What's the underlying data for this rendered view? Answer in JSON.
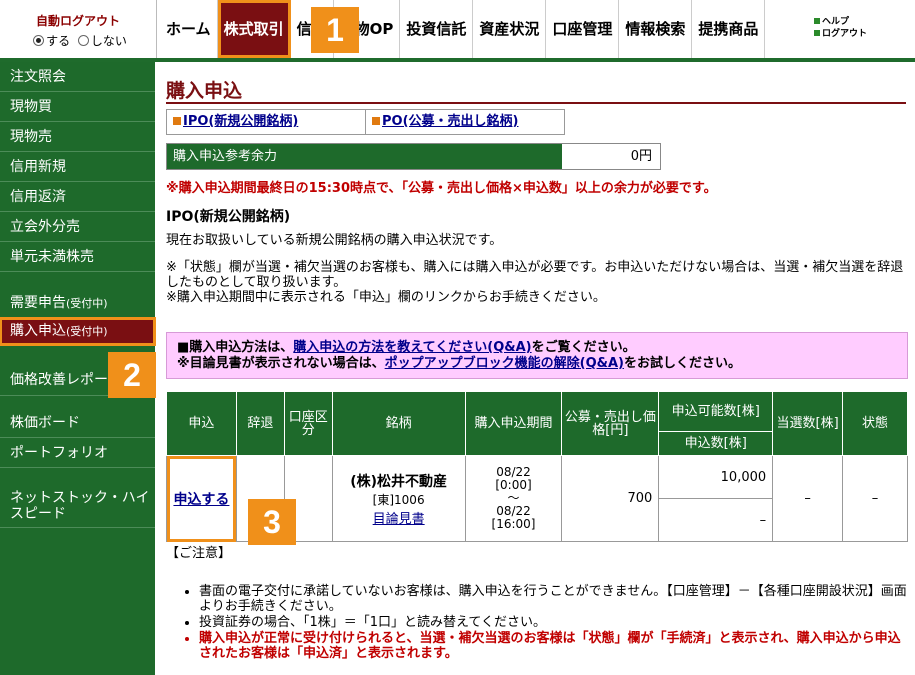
{
  "header": {
    "auto_logout_title": "自動ログアウト",
    "auto_logout_on": "する",
    "auto_logout_off": "しない",
    "nav": [
      "ホーム",
      "株式取引",
      "信用",
      "先物OP",
      "投資信託",
      "資産状況",
      "口座管理",
      "情報検索",
      "提携商品"
    ],
    "help": "ヘルプ",
    "logout": "ログアウト"
  },
  "sidebar": {
    "items": [
      "注文照会",
      "現物買",
      "現物売",
      "信用新規",
      "信用返済",
      "立会外分売",
      "単元未満株売"
    ],
    "demand": "需要申告",
    "demand_sub": "(受付中)",
    "purchase": "購入申込",
    "purchase_sub": "(受付中)",
    "price_report": "価格改善レポート",
    "board": "株価ボード",
    "portfolio": "ポートフォリオ",
    "netstock": "ネットストック・ハイスピード"
  },
  "main": {
    "title": "購入申込",
    "link_ipo": "IPO(新規公開銘柄)",
    "link_po": "PO(公募・売出し銘柄)",
    "balance_label": "購入申込参考余力",
    "balance_value": "0円",
    "warning": "※購入申込期間最終日の15:30時点で、「公募・売出し価格×申込数」以上の余力が必要です。",
    "section_title": "IPO(新規公開銘柄)",
    "section_desc": "現在お取扱いしている新規公開銘柄の購入申込状況です。",
    "notice1": "※「状態」欄が当選・補欠当選のお客様も、購入には購入申込が必要です。お申込いただけない場合は、当選・補欠当選を辞退したものとして取り扱います。",
    "notice2": "※購入申込期間中に表示される「申込」欄のリンクからお手続きください。",
    "pink1_pre": "■購入申込方法は、",
    "pink1_link": "購入申込の方法を教えてください(Q&A)",
    "pink1_post": "をご覧ください。",
    "pink2_pre": "※目論見書が表示されない場合は、",
    "pink2_link": "ポップアップブロック機能の解除(Q&A)",
    "pink2_post": "をお試しください。"
  },
  "table": {
    "headers": {
      "apply": "申込",
      "decline": "辞退",
      "account": "口座区分",
      "name": "銘柄",
      "period": "購入申込期間",
      "price": "公募・売出し価格[円]",
      "possible": "申込可能数[株]",
      "count": "申込数[株]",
      "winning": "当選数[株]",
      "status": "状態"
    },
    "row": {
      "apply_link": "申込する",
      "name": "(株)松井不動産",
      "code": "[東]1006",
      "prospectus": "目論見書",
      "period_from": "08/22",
      "period_from_time": "[0:00]",
      "tilde": "〜",
      "period_to": "08/22",
      "period_to_time": "[16:00]",
      "price": "700",
      "possible": "10,000",
      "count": "–",
      "winning": "–",
      "status": "–"
    }
  },
  "caution": {
    "head": "【ご注意】",
    "items": [
      "書面の電子交付に承諾していないお客様は、購入申込を行うことができません。【口座管理】－【各種口座開設状況】画面よりお手続きください。",
      "投資証券の場合、「1株」＝「1口」と読み替えてください。"
    ],
    "red": "購入申込が正常に受け付けられると、当選・補欠当選のお客様は「状態」欄が「手続済」と表示され、購入申込から申込されたお客様は「申込済」と表示されます。"
  },
  "badges": [
    "1",
    "2",
    "3"
  ]
}
